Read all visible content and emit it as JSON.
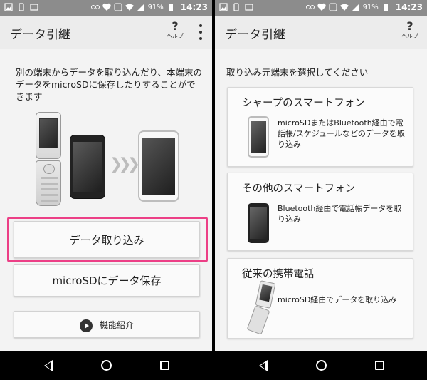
{
  "status_bar": {
    "battery": "91%",
    "time": "14:23"
  },
  "left": {
    "title": "データ引継",
    "help_label": "ヘルプ",
    "help_symbol": "?",
    "description": "別の端末からデータを取り込んだり、本端末のデータをmicroSDに保存したりすることができます",
    "import_button": "データ取り込み",
    "save_button": "microSDにデータ保存",
    "intro_button": "機能紹介"
  },
  "right": {
    "title": "データ引継",
    "help_label": "ヘルプ",
    "help_symbol": "?",
    "prompt": "取り込み元端末を選択してください",
    "cards": [
      {
        "title": "シャープのスマートフォン",
        "desc": "microSDまたはBluetooth経由で電話帳/スケジュールなどのデータを取り込み",
        "icon": "white-smartphone-icon"
      },
      {
        "title": "その他のスマートフォン",
        "desc": "Bluetooth経由で電話帳データを取り込み",
        "icon": "black-smartphone-icon"
      },
      {
        "title": "従来の携帯電話",
        "desc": "microSD経由でデータを取り込み",
        "icon": "flip-phone-icon"
      }
    ]
  },
  "colors": {
    "highlight": "#ec3f86",
    "status_bar": "#8c8c8c",
    "background": "#ececec"
  }
}
